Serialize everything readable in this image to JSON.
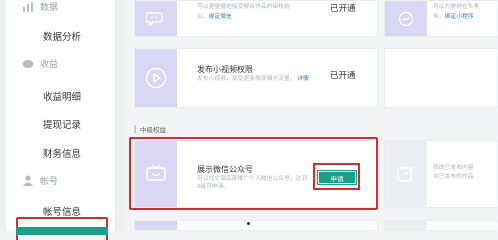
{
  "sidebar": {
    "sections": [
      {
        "label": "数据",
        "icon": "data-chart-icon"
      },
      {
        "label": "收益",
        "icon": "revenue-icon"
      },
      {
        "label": "帐号",
        "icon": "user-icon"
      }
    ],
    "items": {
      "data_analysis": "数据分析",
      "revenue_details": "收益明细",
      "withdraw_records": "提现记录",
      "finance_info": "财务信息",
      "account_info": "帐号信息"
    }
  },
  "cards": {
    "top_left": {
      "desc_line": "可以更便捷地接受报名作品的审核结",
      "link_suffix": "绑定微信",
      "status": "已开通"
    },
    "top_right": {
      "desc_line": "可以方便地在头条",
      "link": "绑定小程序"
    },
    "video": {
      "title": "发布小视频权限",
      "desc_line1": "发布小视频，享受更多展现曝光流量。",
      "desc_link": "详情",
      "status": "已开通"
    },
    "section_title": "中级权益",
    "wechat": {
      "title": "展示微信公众号",
      "desc_line1": "可以在文章底部推广个人微信公众号。达到",
      "desc_line2": "3级可申请。",
      "apply_label": "申请"
    },
    "modify": {
      "desc_line1": "修改已发布内容",
      "desc_line2": "对已发布的作品"
    }
  },
  "colors": {
    "accent_green": "#1aa088",
    "highlight_red": "#cf2f2f",
    "thumb_purple": "#d9d7f3",
    "link_blue": "#3a79c9"
  }
}
